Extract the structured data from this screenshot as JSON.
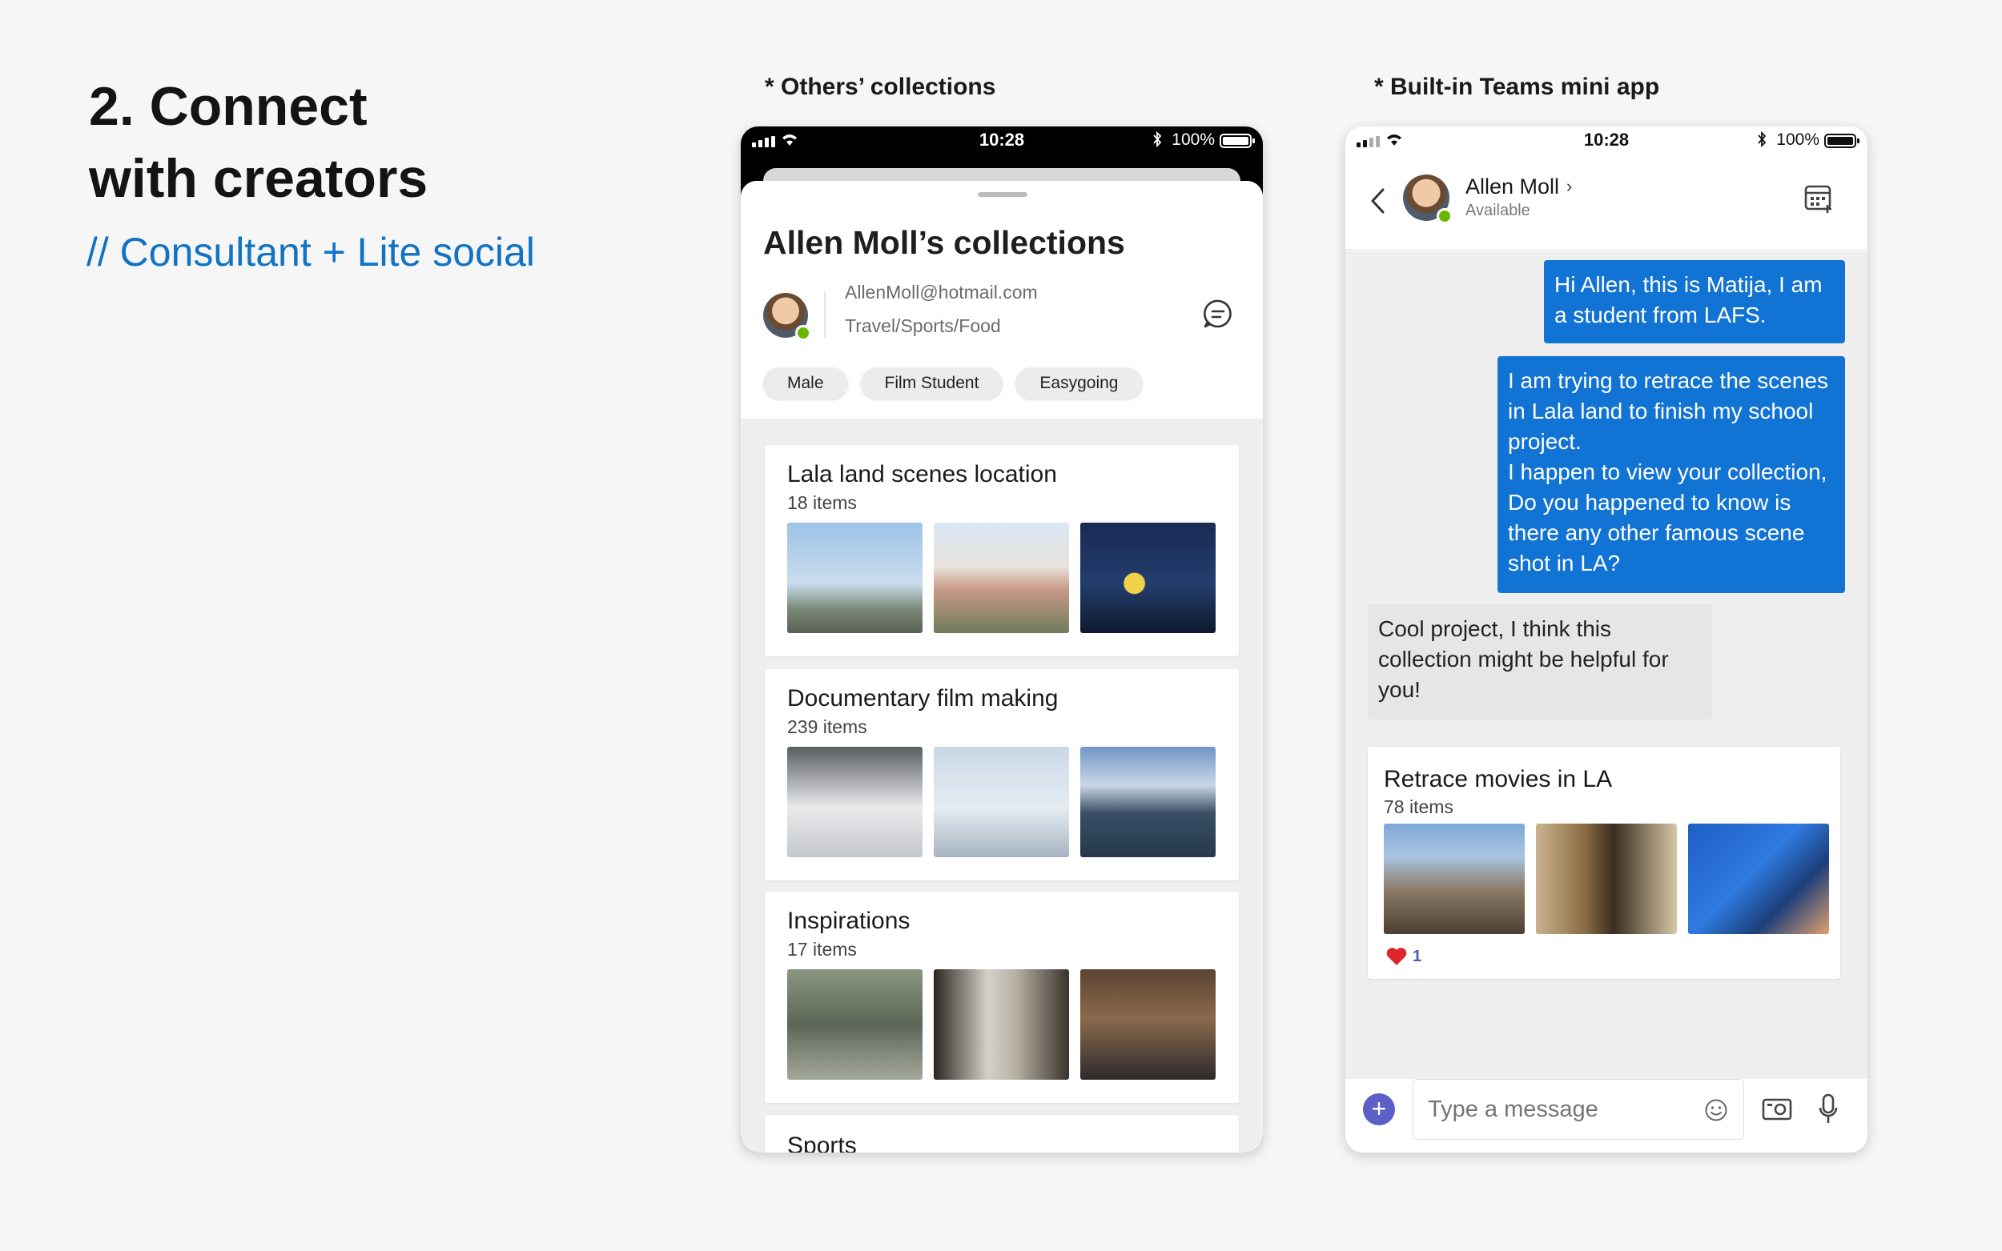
{
  "intro": {
    "heading_line1": "2. Connect",
    "heading_line2": "with creators",
    "subheading": "// Consultant + Lite social"
  },
  "captions": {
    "left": "* Others’ collections",
    "right": "* Built-in Teams mini app"
  },
  "status_bar": {
    "time": "10:28",
    "battery": "100%"
  },
  "collections_screen": {
    "title": "Allen Moll’s collections",
    "email": "AllenMoll@hotmail.com",
    "interests": "Travel/Sports/Food",
    "chips": [
      "Male",
      "Film Student",
      "Easygoing"
    ],
    "collections": [
      {
        "title": "Lala land scenes location",
        "count": "18 items"
      },
      {
        "title": "Documentary film making",
        "count": "239 items"
      },
      {
        "title": "Inspirations",
        "count": "17 items"
      },
      {
        "title": "Sports",
        "count": ""
      }
    ]
  },
  "chat_screen": {
    "contact_name": "Allen Moll",
    "contact_status": "Available",
    "messages": [
      {
        "direction": "out",
        "text": "Hi Allen, this is Matija, I am a student from LAFS."
      },
      {
        "direction": "out",
        "text": " I am trying to retrace the scenes in Lala land to finish my school project.\nI happen to view your collection, Do you happened to know is there any other famous scene shot in LA?"
      },
      {
        "direction": "in",
        "text": "Cool project, I think this collection might be helpful for you!"
      }
    ],
    "shared_card": {
      "title": "Retrace movies in LA",
      "count": "78 items",
      "reaction_count": "1"
    },
    "composer_placeholder": "Type a message"
  },
  "colors": {
    "accent_blue": "#1173d4",
    "subheading_blue": "#1173c4",
    "teams_purple": "#5b5fc7",
    "presence_green": "#6bb700",
    "heart_red": "#e0242c"
  },
  "icons": [
    "signal-icon",
    "wifi-icon",
    "bluetooth-icon",
    "battery-icon",
    "chat-icon",
    "back-chevron-icon",
    "chevron-right-icon",
    "calendar-icon",
    "heart-icon",
    "plus-icon",
    "emoji-icon",
    "camera-icon",
    "mic-icon"
  ]
}
